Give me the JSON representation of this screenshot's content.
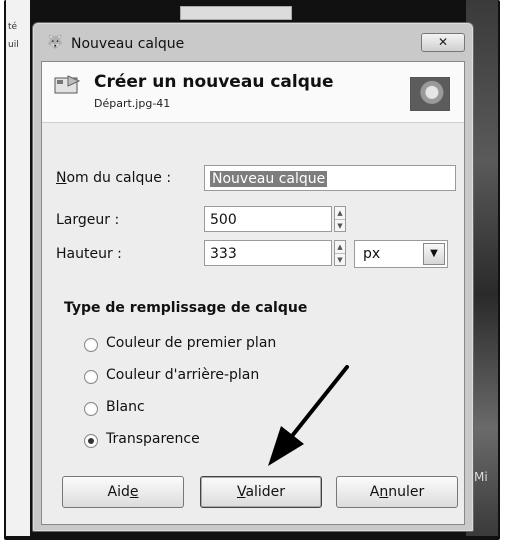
{
  "background": {
    "left_text": "té\nuil",
    "right_text": "Mi"
  },
  "dialog": {
    "title": "Nouveau calque",
    "close_label": "✕",
    "header_title": "Créer un nouveau calque",
    "header_subtitle": "Départ.jpg-41"
  },
  "form": {
    "name": {
      "mnemonic": "N",
      "label_rest": "om du calque :",
      "value": "Nouveau calque"
    },
    "width": {
      "label": "Largeur :",
      "value": "500"
    },
    "height": {
      "label": "Hauteur :",
      "value": "333"
    },
    "unit": {
      "selected": "px"
    }
  },
  "fill_type": {
    "title": "Type de remplissage de calque",
    "options": [
      {
        "label": "Couleur de premier plan",
        "checked": false
      },
      {
        "label": "Couleur d'arrière-plan",
        "checked": false
      },
      {
        "label": "Blanc",
        "checked": false
      },
      {
        "label": "Transparence",
        "checked": true
      }
    ]
  },
  "buttons": {
    "help": {
      "before": "Aid",
      "mnemonic": "e",
      "after": ""
    },
    "ok": {
      "before": "",
      "mnemonic": "V",
      "after": "alider"
    },
    "cancel": {
      "before": "A",
      "mnemonic": "n",
      "after": "nuler"
    }
  },
  "colors": {
    "frame": "#111111",
    "dialog_bg": "#ededed",
    "selection": "#7d7d7d",
    "annotation_arrow": "#000000"
  }
}
